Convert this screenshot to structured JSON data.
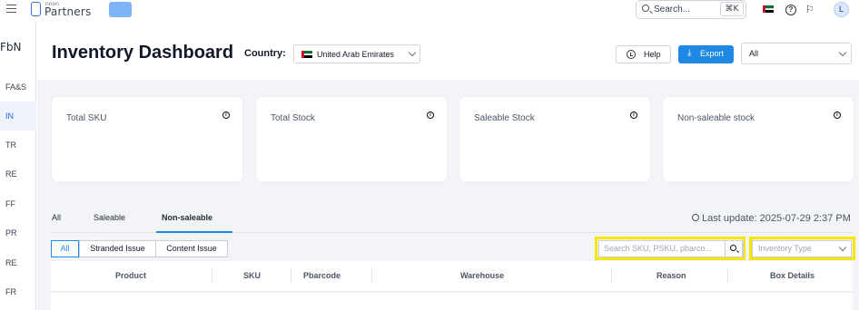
{
  "topbar": {
    "logo_small": "noon",
    "logo_big": "Partners",
    "search_placeholder": "Search...",
    "search_shortcut": "⌘K",
    "avatar_initial": "L"
  },
  "sidebar": {
    "brand": "FbN",
    "items": [
      "FA&S",
      "IN",
      "TR",
      "RE",
      "FF",
      "PR",
      "RE",
      "FR"
    ],
    "active_index": 1
  },
  "header": {
    "title": "Inventory Dashboard",
    "country_label": "Country:",
    "country_value": "United Arab Emirates",
    "help_label": "Help",
    "export_label": "Export",
    "filter_value": "All",
    "export_color": "#1e88e5"
  },
  "cards": [
    {
      "title": "Total SKU"
    },
    {
      "title": "Total Stock"
    },
    {
      "title": "Saleable Stock"
    },
    {
      "title": "Non-saleable stock"
    }
  ],
  "tabs": [
    {
      "label": "All",
      "active": false
    },
    {
      "label": "Saleable",
      "active": false
    },
    {
      "label": "Non-saleable",
      "active": true
    }
  ],
  "last_update": "Last update: 2025-07-29 2:37 PM",
  "filters": {
    "segments": [
      "All",
      "Stranded Issue",
      "Content Issue"
    ],
    "active_segment": "All",
    "search_placeholder": "Search SKU, PSKU, pbarco...",
    "inventory_type_placeholder": "Inventory Type",
    "highlight_color": "#f7e600"
  },
  "table": {
    "columns": [
      "Product",
      "SKU",
      "Pbarcode",
      "Warehouse",
      "Reason",
      "Box Details"
    ]
  }
}
